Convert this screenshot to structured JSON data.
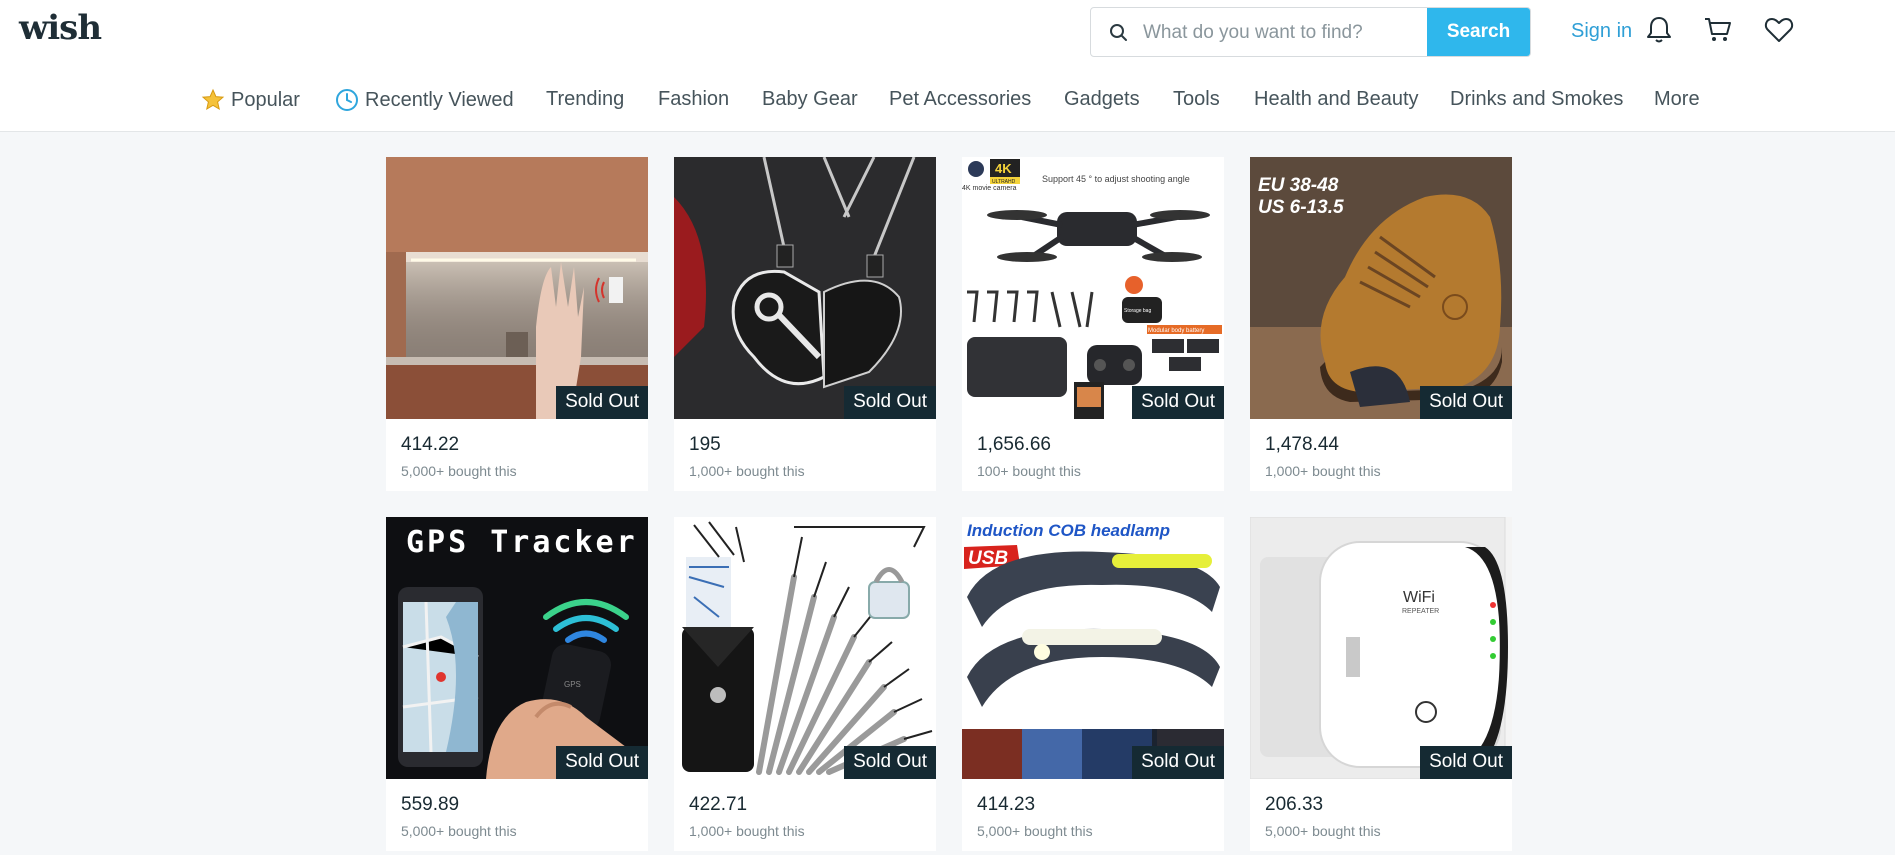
{
  "header": {
    "logo": "wish",
    "search_placeholder": "What do you want to find?",
    "search_button": "Search",
    "sign_in": "Sign in"
  },
  "nav": [
    {
      "label": "Popular",
      "icon": "star-icon"
    },
    {
      "label": "Recently Viewed",
      "icon": "clock-icon"
    },
    {
      "label": "Trending"
    },
    {
      "label": "Fashion"
    },
    {
      "label": "Baby Gear"
    },
    {
      "label": "Pet Accessories"
    },
    {
      "label": "Gadgets"
    },
    {
      "label": "Tools"
    },
    {
      "label": "Health and Beauty"
    },
    {
      "label": "Drinks and Smokes"
    },
    {
      "label": "More"
    }
  ],
  "products": [
    {
      "price": "414.22",
      "bought": "5,000+ bought this",
      "badge": "Sold Out",
      "image": "led-strip-kitchen"
    },
    {
      "price": "195",
      "bought": "1,000+ bought this",
      "badge": "Sold Out",
      "image": "heart-key-necklace"
    },
    {
      "price": "1,656.66",
      "bought": "100+ bought this",
      "badge": "Sold Out",
      "image": "4k-drone-kit",
      "image_text": {
        "badge": "4K",
        "badge_sub": "ULTRAHD",
        "caption": "4K movie camera",
        "note": "Support 45 ° to adjust shooting angle",
        "bag": "Storage bag",
        "battery": "Modular body battery"
      }
    },
    {
      "price": "1,478.44",
      "bought": "1,000+ bought this",
      "badge": "Sold Out",
      "image": "leather-boot",
      "image_text": {
        "line1": "EU 38-48",
        "line2": "US 6-13.5"
      }
    },
    {
      "price": "559.89",
      "bought": "5,000+ bought this",
      "badge": "Sold Out",
      "image": "gps-tracker",
      "image_text": {
        "title": "GPS Tracker",
        "device": "GPS"
      }
    },
    {
      "price": "422.71",
      "bought": "1,000+ bought this",
      "badge": "Sold Out",
      "image": "lock-pick-set"
    },
    {
      "price": "414.23",
      "bought": "5,000+ bought this",
      "badge": "Sold Out",
      "image": "cob-headlamp",
      "image_text": {
        "title": "Induction COB headlamp",
        "tag": "USB"
      }
    },
    {
      "price": "206.33",
      "bought": "5,000+ bought this",
      "badge": "Sold Out",
      "image": "wifi-repeater",
      "image_text": {
        "brand": "WiFi",
        "sub": "REPEATER"
      }
    }
  ],
  "colors": {
    "accent": "#2fb7ec",
    "link": "#2f9fd6",
    "badge": "#152a33",
    "background": "#f5f7f9"
  }
}
